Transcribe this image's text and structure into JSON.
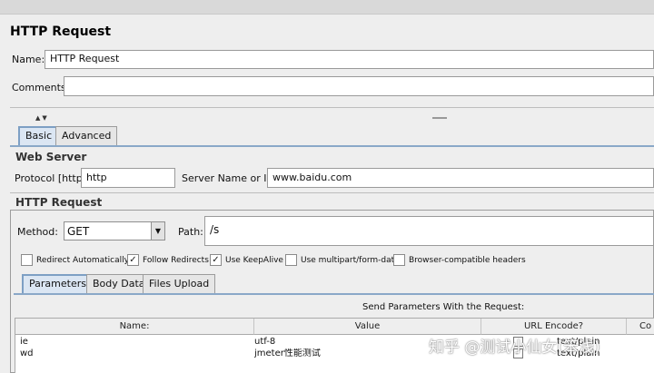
{
  "panel_title": "HTTP Request",
  "name_label": "Name:",
  "name_value": "HTTP Request",
  "comments_label": "Comments:",
  "comments_value": "",
  "tabs": [
    "Basic",
    "Advanced"
  ],
  "web_server": {
    "title": "Web Server",
    "protocol_label": "Protocol [http]:",
    "protocol_value": "http",
    "server_label": "Server Name or IP:",
    "server_value": "www.baidu.com"
  },
  "http_request": {
    "title": "HTTP Request",
    "method_label": "Method:",
    "method_value": "GET",
    "path_label": "Path:",
    "path_value": "/s"
  },
  "options": [
    {
      "label": "Redirect Automatically",
      "checked": false
    },
    {
      "label": "Follow Redirects",
      "checked": true
    },
    {
      "label": "Use KeepAlive",
      "checked": true
    },
    {
      "label": "Use multipart/form-data",
      "checked": false
    },
    {
      "label": "Browser-compatible headers",
      "checked": false
    }
  ],
  "subtabs": [
    "Parameters",
    "Body Data",
    "Files Upload"
  ],
  "params": {
    "heading": "Send Parameters With the Request:",
    "columns": [
      "Name:",
      "Value",
      "URL Encode?",
      "Co"
    ],
    "rows": [
      {
        "name": "ie",
        "value": "utf-8",
        "encode": false,
        "content": "text/plain"
      },
      {
        "name": "wd",
        "value": "jmeter性能测试",
        "encode": true,
        "content": "text/plain"
      }
    ]
  },
  "watermark": "知乎 @测试小仙女(笨浅)"
}
